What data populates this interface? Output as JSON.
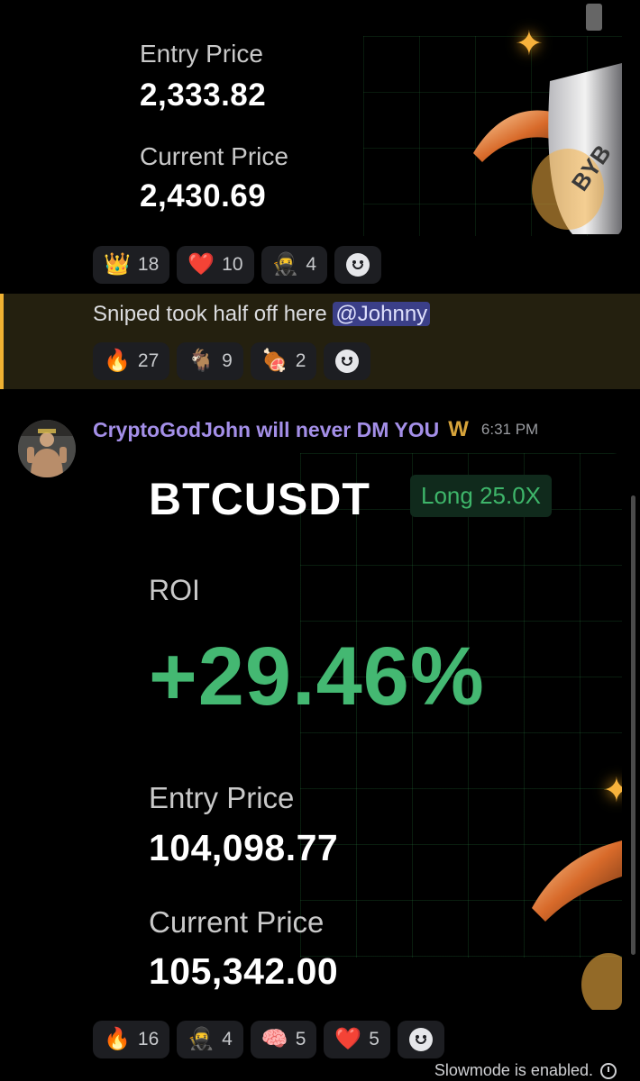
{
  "trade_card_top": {
    "entry_label": "Entry Price",
    "entry_value": "2,333.82",
    "current_label": "Current Price",
    "current_value": "2,430.69",
    "brand_text": "BYB"
  },
  "reactions_1": [
    {
      "icon": "crown-emoji",
      "emoji": "👑",
      "count": "18"
    },
    {
      "icon": "heart-emoji",
      "emoji": "❤️",
      "count": "10"
    },
    {
      "icon": "custom-person-emoji",
      "emoji": "🥷",
      "count": "4"
    }
  ],
  "mention_message": {
    "text": "Sniped took half off here",
    "mention": "@Johnny"
  },
  "reactions_2": [
    {
      "icon": "fire-emoji",
      "emoji": "🔥",
      "count": "27"
    },
    {
      "icon": "goat-emoji",
      "emoji": "🐐",
      "count": "9"
    },
    {
      "icon": "custom-meat-emoji",
      "emoji": "🍖",
      "count": "2"
    }
  ],
  "post": {
    "author": "CryptoGodJohn will never DM YOU",
    "badge": "W",
    "time": "6:31 PM"
  },
  "trade_card_main": {
    "symbol": "BTCUSDT",
    "position": "Long 25.0X",
    "roi_label": "ROI",
    "roi_value": "+29.46%",
    "entry_label": "Entry Price",
    "entry_value": "104,098.77",
    "current_label": "Current Price",
    "current_value": "105,342.00"
  },
  "reactions_3": [
    {
      "icon": "fire-emoji",
      "emoji": "🔥",
      "count": "16"
    },
    {
      "icon": "custom-person-emoji",
      "emoji": "🥷",
      "count": "4"
    },
    {
      "icon": "custom-brain-emoji",
      "emoji": "🧠",
      "count": "5"
    },
    {
      "icon": "heart-emoji",
      "emoji": "❤️",
      "count": "5"
    }
  ],
  "footer": {
    "slowmode": "Slowmode is enabled."
  },
  "colors": {
    "roi_green": "#44b872",
    "author_purple": "#a48fe8",
    "mention_highlight": "#24200f",
    "mention_bar": "#f0b232"
  }
}
